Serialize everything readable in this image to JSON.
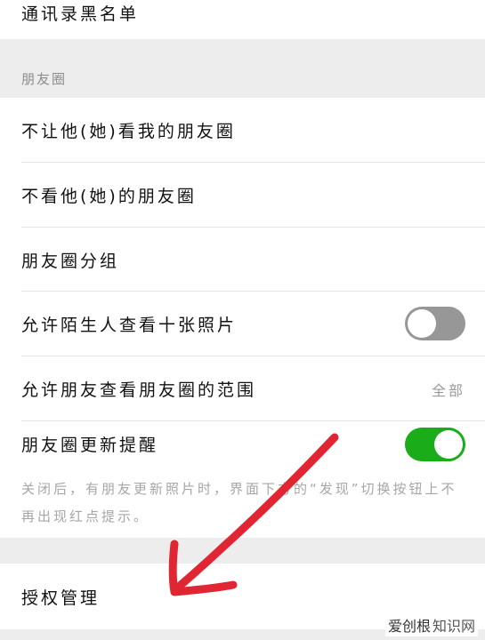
{
  "rows": {
    "blacklist": "通讯录黑名单",
    "moments_header": "朋友圈",
    "hide_my_moments": "不让他(她)看我的朋友圈",
    "hide_their_moments": "不看他(她)的朋友圈",
    "moments_groups": "朋友圈分组",
    "allow_strangers": "允许陌生人查看十张照片",
    "friends_view_range": "允许朋友查看朋友圈的范围",
    "friends_view_range_value": "全部",
    "moments_update_reminder": "朋友圈更新提醒",
    "reminder_note": "关闭后，有朋友更新照片时，界面下方的“发现”切换按钮上不再出现红点提示。",
    "authorization": "授权管理"
  },
  "toggles": {
    "allow_strangers": false,
    "moments_update_reminder": true
  },
  "watermark": {
    "brand": "爱创根",
    "text": "知识网"
  },
  "colors": {
    "toggle_on": "#1aad19",
    "toggle_off": "#979797",
    "annotation_arrow": "#e02533"
  }
}
